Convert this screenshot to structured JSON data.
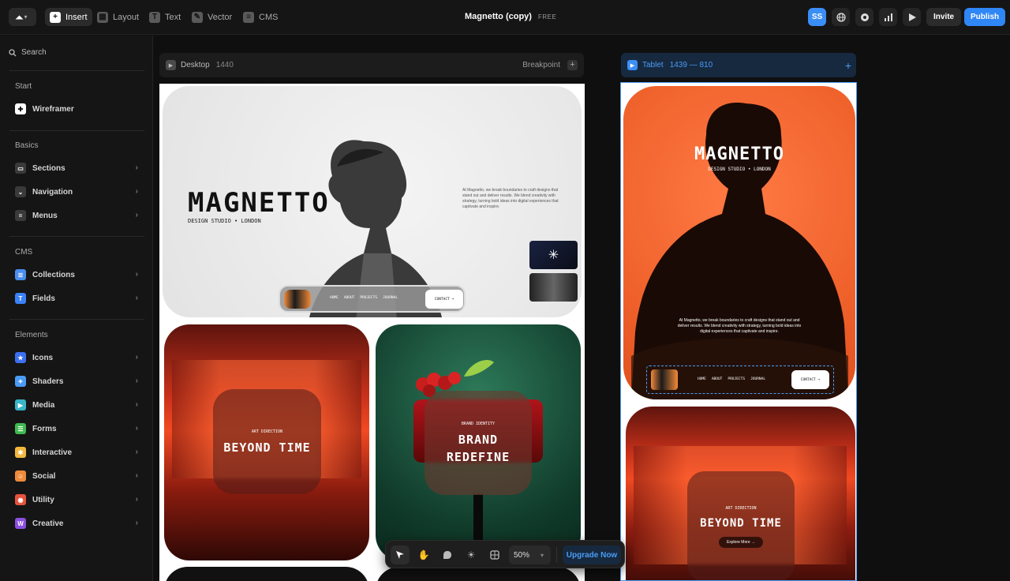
{
  "topbar": {
    "tools": [
      {
        "label": "Insert",
        "icon": "plus-icon"
      },
      {
        "label": "Layout",
        "icon": "layout-icon"
      },
      {
        "label": "Text",
        "icon": "text-icon"
      },
      {
        "label": "Vector",
        "icon": "pen-icon"
      },
      {
        "label": "CMS",
        "icon": "database-icon"
      }
    ],
    "project_title": "Magnetto (copy)",
    "plan_badge": "FREE",
    "avatar_initials": "SS",
    "invite_label": "Invite",
    "publish_label": "Publish"
  },
  "sidebar": {
    "search_label": "Search",
    "sections": [
      {
        "title": "Start",
        "items": [
          {
            "label": "Wireframer",
            "icon": "wireframer-icon",
            "color": "#ffffff"
          }
        ]
      },
      {
        "title": "Basics",
        "items": [
          {
            "label": "Sections",
            "icon": "sections-icon",
            "color": "#3a3a3a"
          },
          {
            "label": "Navigation",
            "icon": "navigation-icon",
            "color": "#3a3a3a"
          },
          {
            "label": "Menus",
            "icon": "menus-icon",
            "color": "#3a3a3a"
          }
        ]
      },
      {
        "title": "CMS",
        "items": [
          {
            "label": "Collections",
            "icon": "collections-icon",
            "color": "#4a8df0"
          },
          {
            "label": "Fields",
            "icon": "fields-icon",
            "color": "#3b82f6"
          }
        ]
      },
      {
        "title": "Elements",
        "items": [
          {
            "label": "Icons",
            "icon": "star-icon",
            "color": "#3b6ff0"
          },
          {
            "label": "Shaders",
            "icon": "shaders-icon",
            "color": "#4a9bf5"
          },
          {
            "label": "Media",
            "icon": "media-icon",
            "color": "#38b5c9"
          },
          {
            "label": "Forms",
            "icon": "forms-icon",
            "color": "#3fb950"
          },
          {
            "label": "Interactive",
            "icon": "interactive-icon",
            "color": "#f2b73d"
          },
          {
            "label": "Social",
            "icon": "social-icon",
            "color": "#ef8a3a"
          },
          {
            "label": "Utility",
            "icon": "utility-icon",
            "color": "#e5533d"
          },
          {
            "label": "Creative",
            "icon": "creative-icon",
            "color": "#8b4fe0"
          }
        ]
      }
    ]
  },
  "desktop_frame": {
    "name": "Desktop",
    "width": "1440",
    "breakpoint_label": "Breakpoint",
    "hero_title": "MAGNETTO",
    "hero_subtitle": "DESIGN STUDIO • LONDON",
    "hero_blurb": "At Magnetto, we break boundaries to craft designs that stand out and deliver results. We blend creativity with strategy, turning bold ideas into digital experiences that captivate and inspire.",
    "nav_links": [
      "HOME",
      "ABOUT",
      "PROJECTS",
      "JOURNAL"
    ],
    "contact_label": "CONTACT →",
    "card1": {
      "eyebrow": "ART DIRECTION",
      "title": "BEYOND TIME"
    },
    "card2": {
      "eyebrow": "BRAND IDENTITY",
      "title_line1": "BRAND",
      "title_line2": "REDEFINE"
    }
  },
  "tablet_frame": {
    "name": "Tablet",
    "size": "1439 — 810",
    "hero_title": "MAGNETTO",
    "hero_subtitle": "DESIGN STUDIO • LONDON",
    "hero_blurb": "At Magnetto, we break boundaries to craft designs that stand out and deliver results. We blend creativity with strategy, turning bold ideas into digital experiences that captivate and inspire.",
    "nav_links": [
      "HOME",
      "ABOUT",
      "PROJECTS",
      "JOURNAL"
    ],
    "contact_label": "CONTACT →",
    "card": {
      "eyebrow": "ART DIRECTION",
      "title": "BEYOND TIME",
      "cta": "Explore More →"
    }
  },
  "dock": {
    "zoom": "50%",
    "upgrade_label": "Upgrade Now"
  },
  "colors": {
    "accent": "#2f86f5",
    "tablet_accent": "#4a9cf5",
    "orange": "#f0622c",
    "red_deep": "#8a1a12"
  }
}
